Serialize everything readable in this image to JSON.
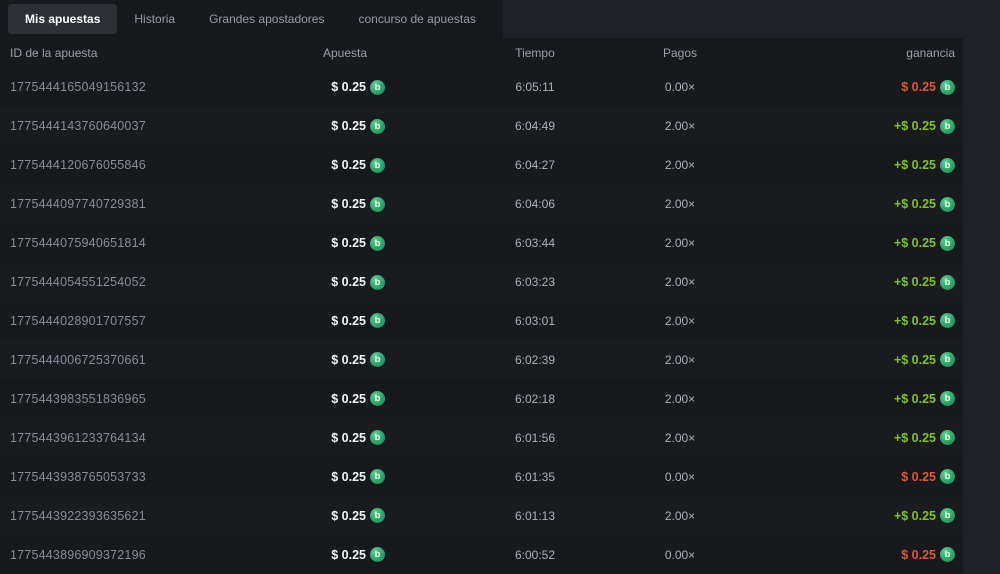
{
  "tabs": [
    {
      "label": "Mis apuestas",
      "active": true
    },
    {
      "label": "Historia",
      "active": false
    },
    {
      "label": "Grandes apostadores",
      "active": false
    },
    {
      "label": "concurso de apuestas",
      "active": false
    }
  ],
  "table": {
    "columns": {
      "id": "ID de la apuesta",
      "bet": "Apuesta",
      "time": "Tiempo",
      "payout": "Pagos",
      "profit": "ganancia"
    },
    "rows": [
      {
        "id": "1775444165049156132",
        "bet": "$ 0.25",
        "time": "6:05:11",
        "payout": "0.00×",
        "profit": "$ 0.25",
        "result": "loss"
      },
      {
        "id": "1775444143760640037",
        "bet": "$ 0.25",
        "time": "6:04:49",
        "payout": "2.00×",
        "profit": "+$ 0.25",
        "result": "win"
      },
      {
        "id": "1775444120676055846",
        "bet": "$ 0.25",
        "time": "6:04:27",
        "payout": "2.00×",
        "profit": "+$ 0.25",
        "result": "win"
      },
      {
        "id": "1775444097740729381",
        "bet": "$ 0.25",
        "time": "6:04:06",
        "payout": "2.00×",
        "profit": "+$ 0.25",
        "result": "win"
      },
      {
        "id": "1775444075940651814",
        "bet": "$ 0.25",
        "time": "6:03:44",
        "payout": "2.00×",
        "profit": "+$ 0.25",
        "result": "win"
      },
      {
        "id": "1775444054551254052",
        "bet": "$ 0.25",
        "time": "6:03:23",
        "payout": "2.00×",
        "profit": "+$ 0.25",
        "result": "win"
      },
      {
        "id": "1775444028901707557",
        "bet": "$ 0.25",
        "time": "6:03:01",
        "payout": "2.00×",
        "profit": "+$ 0.25",
        "result": "win"
      },
      {
        "id": "1775444006725370661",
        "bet": "$ 0.25",
        "time": "6:02:39",
        "payout": "2.00×",
        "profit": "+$ 0.25",
        "result": "win"
      },
      {
        "id": "1775443983551836965",
        "bet": "$ 0.25",
        "time": "6:02:18",
        "payout": "2.00×",
        "profit": "+$ 0.25",
        "result": "win"
      },
      {
        "id": "1775443961233764134",
        "bet": "$ 0.25",
        "time": "6:01:56",
        "payout": "2.00×",
        "profit": "+$ 0.25",
        "result": "win"
      },
      {
        "id": "1775443938765053733",
        "bet": "$ 0.25",
        "time": "6:01:35",
        "payout": "0.00×",
        "profit": "$ 0.25",
        "result": "loss"
      },
      {
        "id": "1775443922393635621",
        "bet": "$ 0.25",
        "time": "6:01:13",
        "payout": "2.00×",
        "profit": "+$ 0.25",
        "result": "win"
      },
      {
        "id": "1775443896909372196",
        "bet": "$ 0.25",
        "time": "6:00:52",
        "payout": "0.00×",
        "profit": "$ 0.25",
        "result": "loss"
      }
    ]
  },
  "icons": {
    "currency": {
      "name": "bcd-coin-icon",
      "glyph": "b",
      "color": "#2aa56b"
    }
  },
  "colors": {
    "win": "#7fc41c",
    "loss": "#e2572d",
    "panel_bg": "#17191d",
    "page_bg": "#1e2128",
    "active_tab_bg": "#2d3037"
  }
}
